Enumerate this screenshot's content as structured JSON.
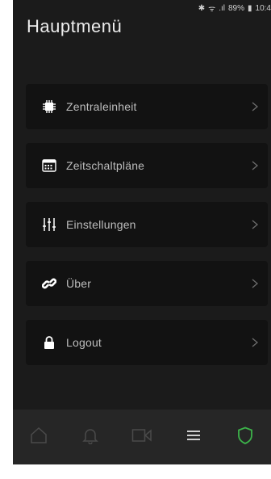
{
  "status_bar": {
    "bluetooth_icon": "bluetooth-icon",
    "wifi_icon": "wifi-icon",
    "signal_icon": "signal-icon",
    "battery_text": "89%",
    "battery_icon": "battery-icon",
    "time": "10:4"
  },
  "header": {
    "title": "Hauptmenü"
  },
  "menu": {
    "items": [
      {
        "label": "Zentraleinheit",
        "icon": "chip-icon"
      },
      {
        "label": "Zeitschaltpläne",
        "icon": "calendar-icon"
      },
      {
        "label": "Einstellungen",
        "icon": "sliders-icon"
      },
      {
        "label": "Über",
        "icon": "link-icon"
      },
      {
        "label": "Logout",
        "icon": "lock-icon"
      }
    ],
    "chevron_glyph": ">"
  },
  "navbar": {
    "items": [
      {
        "icon": "home-icon",
        "active": false
      },
      {
        "icon": "bell-icon",
        "active": false
      },
      {
        "icon": "video-icon",
        "active": false
      },
      {
        "icon": "menu-icon",
        "active": false
      },
      {
        "icon": "shield-icon",
        "active": true
      }
    ]
  },
  "colors": {
    "background": "#1b1b1b",
    "card": "#121212",
    "navbar": "#262626",
    "text": "#bdbdbd",
    "icon": "#ffffff",
    "inactive_nav_icon": "#4a4a4a",
    "accent_green": "#3cb34a"
  }
}
